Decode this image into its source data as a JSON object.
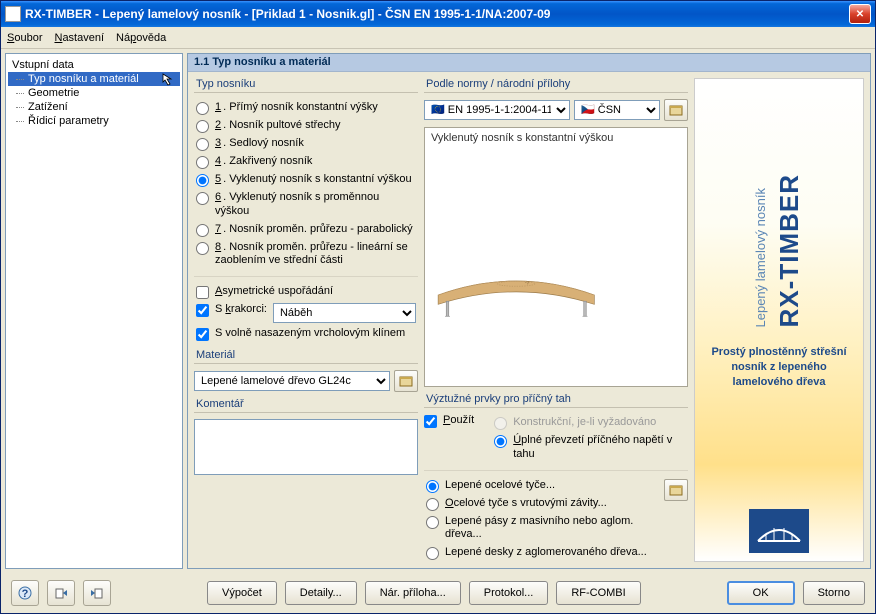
{
  "window": {
    "title": "RX-TIMBER - Lepený lamelový nosník - [Priklad 1 - Nosnik.gl] - ČSN EN 1995-1-1/NA:2007-09"
  },
  "menu": {
    "file": "Soubor",
    "settings": "Nastavení",
    "help": "Nápověda"
  },
  "tree": {
    "root": "Vstupní data",
    "items": [
      "Typ nosníku a materiál",
      "Geometrie",
      "Zatížení",
      "Řídicí parametry"
    ],
    "selected": 0
  },
  "panel": {
    "heading": "1.1 Typ nosníku a materiál",
    "type_group": "Typ nosníku",
    "radios": [
      "Přímý nosník konstantní výšky",
      "Nosník pultové střechy",
      "Sedlový nosník",
      "Zakřivený nosník",
      "Vyklenutý nosník s konstantní výškou",
      "Vyklenutý nosník s proměnnou výškou",
      "Nosník proměn. průřezu - parabolický",
      "Nosník proměn. průřezu - lineární se zaoblením ve střední části"
    ],
    "selected_radio": 4,
    "asym": "Asymetrické uspořádání",
    "krak": "S krakorci:",
    "krak_val": "Náběh",
    "vrchol": "S volně nasazeným vrcholovým klínem",
    "material_label": "Materiál",
    "material_val": "Lepené lamelové dřevo GL24c",
    "comment_label": "Komentář"
  },
  "norm": {
    "group": "Podle normy / národní přílohy",
    "std": "EN 1995-1-1:2004-11",
    "na": "ČSN",
    "preview_label": "Vyklenutý nosník s konstantní výškou"
  },
  "rein": {
    "group": "Výztužné prvky pro příčný tah",
    "use": "Použít",
    "opt_constr": "Konstrukční, je-li vyžadováno",
    "opt_full": "Úplné převzetí příčného napětí v tahu",
    "r1": "Lepené ocelové tyče...",
    "r2": "Ocelové tyče s vrutovými závity...",
    "r3": "Lepené pásy z masivního nebo aglom. dřeva...",
    "r4": "Lepené desky z aglomerovaného dřeva..."
  },
  "brand": {
    "name": "RX-TIMBER",
    "sub": "Lepený lamelový nosník",
    "desc": "Prostý plnostěnný střešní nosník z lepeného lamelového dřeva"
  },
  "footer": {
    "calc": "Výpočet",
    "details": "Detaily...",
    "annex": "Nár. příloha...",
    "protocol": "Protokol...",
    "rfcombi": "RF-COMBI",
    "ok": "OK",
    "cancel": "Storno"
  }
}
